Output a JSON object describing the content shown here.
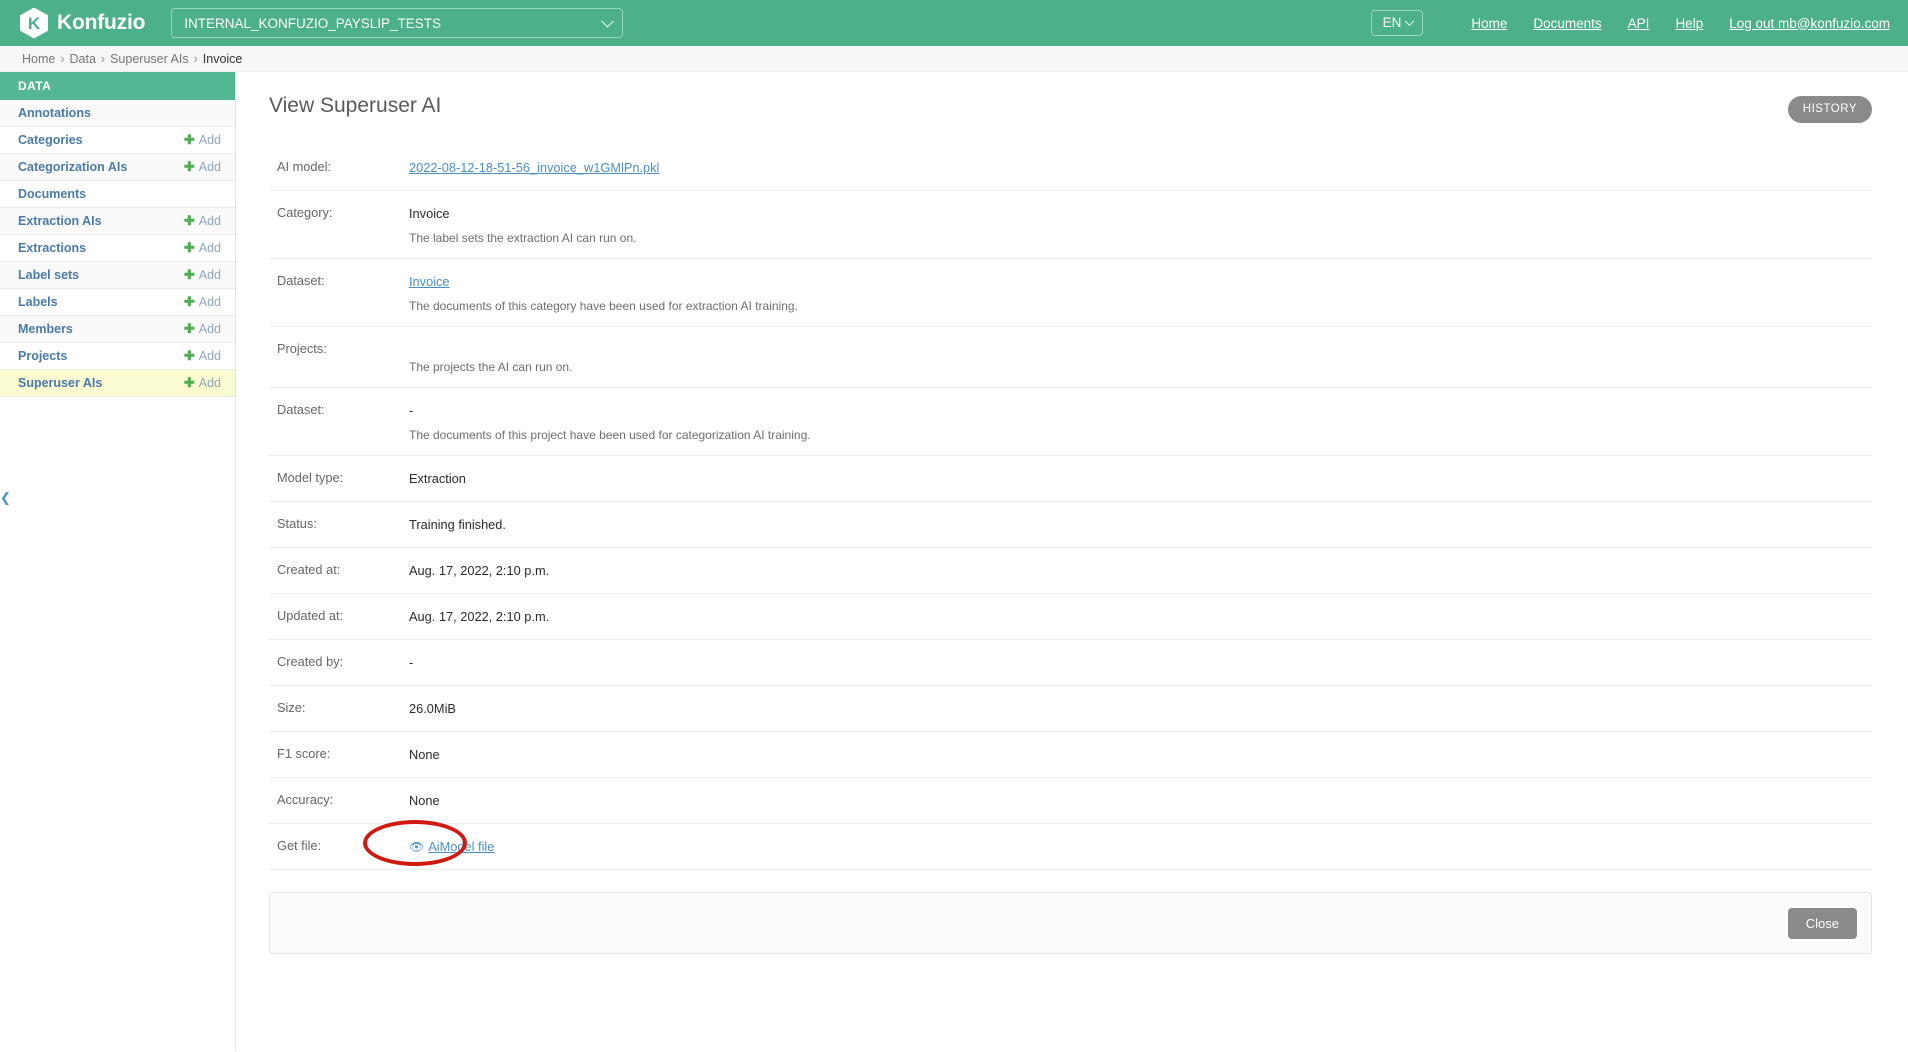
{
  "topbar": {
    "brand_name": "Konfuzio",
    "brand_mark_letter": "K",
    "project_selected": "INTERNAL_KONFUZIO_PAYSLIP_TESTS",
    "language": "EN",
    "nav": [
      {
        "label": "Home"
      },
      {
        "label": "Documents"
      },
      {
        "label": "API"
      },
      {
        "label": "Help"
      },
      {
        "label": "Log out mb@konfuzio.com"
      }
    ],
    "accent_color": "#4cb08a"
  },
  "breadcrumb": {
    "items": [
      "Home",
      "Data",
      "Superuser AIs"
    ],
    "current": "Invoice",
    "separator": "›"
  },
  "sidebar": {
    "header": "DATA",
    "add_label": "Add",
    "add_icon": "plus-icon",
    "collapse_icon": "chevron-left-icon",
    "items": [
      {
        "label": "Annotations",
        "add": false,
        "active": false
      },
      {
        "label": "Categories",
        "add": true,
        "active": false
      },
      {
        "label": "Categorization AIs",
        "add": true,
        "active": false
      },
      {
        "label": "Documents",
        "add": false,
        "active": false
      },
      {
        "label": "Extraction AIs",
        "add": true,
        "active": false
      },
      {
        "label": "Extractions",
        "add": true,
        "active": false
      },
      {
        "label": "Label sets",
        "add": true,
        "active": false
      },
      {
        "label": "Labels",
        "add": true,
        "active": false
      },
      {
        "label": "Members",
        "add": true,
        "active": false
      },
      {
        "label": "Projects",
        "add": true,
        "active": false
      },
      {
        "label": "Superuser AIs",
        "add": true,
        "active": true
      }
    ]
  },
  "main": {
    "title": "View Superuser AI",
    "history_label": "HISTORY",
    "close_label": "Close",
    "rows": [
      {
        "label": "AI model:",
        "value": "2022-08-12-18-51-56_invoice_w1GMlPn.pkl",
        "is_link": true,
        "help": ""
      },
      {
        "label": "Category:",
        "value": "Invoice",
        "is_link": false,
        "help": "The label sets the extraction AI can run on."
      },
      {
        "label": "Dataset:",
        "value": "Invoice",
        "is_link": true,
        "help": "The documents of this category have been used for extraction AI training."
      },
      {
        "label": "Projects:",
        "value": "",
        "is_link": false,
        "help": "The projects the AI can run on."
      },
      {
        "label": "Dataset:",
        "value": "-",
        "is_link": false,
        "help": "The documents of this project have been used for categorization AI training."
      },
      {
        "label": "Model type:",
        "value": "Extraction",
        "is_link": false,
        "help": ""
      },
      {
        "label": "Status:",
        "value": "Training finished.",
        "is_link": false,
        "help": ""
      },
      {
        "label": "Created at:",
        "value": "Aug. 17, 2022, 2:10 p.m.",
        "is_link": false,
        "help": ""
      },
      {
        "label": "Updated at:",
        "value": "Aug. 17, 2022, 2:10 p.m.",
        "is_link": false,
        "help": ""
      },
      {
        "label": "Created by:",
        "value": "-",
        "is_link": false,
        "help": ""
      },
      {
        "label": "Size:",
        "value": "26.0MiB",
        "is_link": false,
        "help": ""
      },
      {
        "label": "F1 score:",
        "value": "None",
        "is_link": false,
        "help": ""
      },
      {
        "label": "Accuracy:",
        "value": "None",
        "is_link": false,
        "help": ""
      }
    ],
    "get_file": {
      "label": "Get file:",
      "link_text": "AiModel file",
      "icon": "eye-icon",
      "annotation": {
        "shape": "ellipse",
        "color": "#d01a10"
      }
    }
  }
}
